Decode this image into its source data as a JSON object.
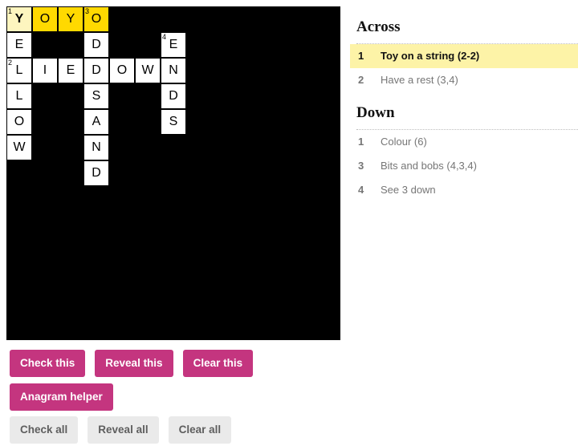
{
  "grid": {
    "rows": 13,
    "cols": 13,
    "cell_size": 32,
    "colors": {
      "block": "#000000",
      "light": "#ffffff",
      "highlight_word": "#ffd900",
      "highlight_cursor": "#fdf5bf"
    },
    "cells": [
      {
        "r": 0,
        "c": 0,
        "letter": "Y",
        "num": "1",
        "state": "cursor"
      },
      {
        "r": 0,
        "c": 1,
        "letter": "O",
        "num": "",
        "state": "hl"
      },
      {
        "r": 0,
        "c": 2,
        "letter": "Y",
        "num": "",
        "state": "hl"
      },
      {
        "r": 0,
        "c": 3,
        "letter": "O",
        "num": "3",
        "state": "hl"
      },
      {
        "r": 1,
        "c": 0,
        "letter": "E",
        "num": "",
        "state": "light"
      },
      {
        "r": 1,
        "c": 3,
        "letter": "D",
        "num": "",
        "state": "light"
      },
      {
        "r": 1,
        "c": 6,
        "letter": "E",
        "num": "4",
        "state": "light"
      },
      {
        "r": 2,
        "c": 0,
        "letter": "L",
        "num": "2",
        "state": "light"
      },
      {
        "r": 2,
        "c": 1,
        "letter": "I",
        "num": "",
        "state": "light"
      },
      {
        "r": 2,
        "c": 2,
        "letter": "E",
        "num": "",
        "state": "light"
      },
      {
        "r": 2,
        "c": 3,
        "letter": "D",
        "num": "",
        "state": "light"
      },
      {
        "r": 2,
        "c": 4,
        "letter": "O",
        "num": "",
        "state": "light"
      },
      {
        "r": 2,
        "c": 5,
        "letter": "W",
        "num": "",
        "state": "light"
      },
      {
        "r": 2,
        "c": 6,
        "letter": "N",
        "num": "",
        "state": "light"
      },
      {
        "r": 3,
        "c": 0,
        "letter": "L",
        "num": "",
        "state": "light"
      },
      {
        "r": 3,
        "c": 3,
        "letter": "S",
        "num": "",
        "state": "light"
      },
      {
        "r": 3,
        "c": 6,
        "letter": "D",
        "num": "",
        "state": "light"
      },
      {
        "r": 4,
        "c": 0,
        "letter": "O",
        "num": "",
        "state": "light"
      },
      {
        "r": 4,
        "c": 3,
        "letter": "A",
        "num": "",
        "state": "light"
      },
      {
        "r": 4,
        "c": 6,
        "letter": "S",
        "num": "",
        "state": "light"
      },
      {
        "r": 5,
        "c": 0,
        "letter": "W",
        "num": "",
        "state": "light"
      },
      {
        "r": 5,
        "c": 3,
        "letter": "N",
        "num": "",
        "state": "light"
      },
      {
        "r": 6,
        "c": 3,
        "letter": "D",
        "num": "",
        "state": "light"
      }
    ],
    "separators": [
      {
        "r": 0,
        "c": 1,
        "kind": "hyphen-right"
      }
    ]
  },
  "clues": {
    "across": {
      "heading": "Across",
      "items": [
        {
          "num": "1",
          "text": "Toy on a string (2-2)",
          "active": true
        },
        {
          "num": "2",
          "text": "Have a rest (3,4)",
          "active": false
        }
      ]
    },
    "down": {
      "heading": "Down",
      "items": [
        {
          "num": "1",
          "text": "Colour (6)",
          "active": false
        },
        {
          "num": "3",
          "text": "Bits and bobs (4,3,4)",
          "active": false
        },
        {
          "num": "4",
          "text": "See 3 down",
          "active": false
        }
      ]
    }
  },
  "buttons": {
    "primary_color": "#c4357f",
    "secondary_color": "#eaeaea",
    "row1": [
      {
        "label": "Check this",
        "name": "check-this-button"
      },
      {
        "label": "Reveal this",
        "name": "reveal-this-button"
      },
      {
        "label": "Clear this",
        "name": "clear-this-button"
      }
    ],
    "row2": [
      {
        "label": "Anagram helper",
        "name": "anagram-helper-button"
      }
    ],
    "row3": [
      {
        "label": "Check all",
        "name": "check-all-button"
      },
      {
        "label": "Reveal all",
        "name": "reveal-all-button"
      },
      {
        "label": "Clear all",
        "name": "clear-all-button"
      }
    ]
  }
}
